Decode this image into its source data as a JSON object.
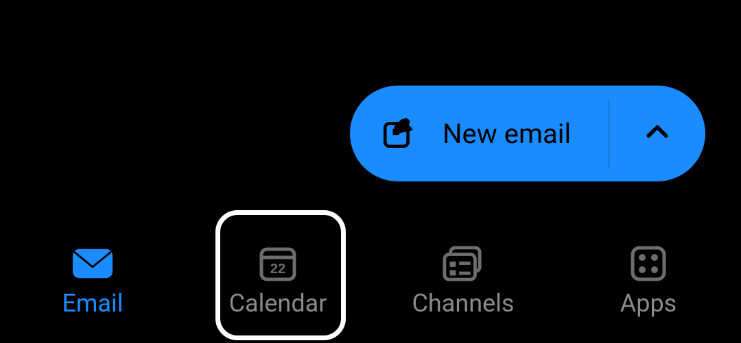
{
  "fab": {
    "label": "New email",
    "compose_icon": "compose",
    "expand_icon": "chevron-up"
  },
  "nav": {
    "items": [
      {
        "label": "Email",
        "icon": "mail",
        "active": true
      },
      {
        "label": "Calendar",
        "icon": "calendar",
        "active": false,
        "badge": "22"
      },
      {
        "label": "Channels",
        "icon": "channels",
        "active": false
      },
      {
        "label": "Apps",
        "icon": "apps",
        "active": false
      }
    ]
  },
  "colors": {
    "accent": "#1a8cff",
    "inactive": "#8a8a8a",
    "bg": "#000000"
  }
}
